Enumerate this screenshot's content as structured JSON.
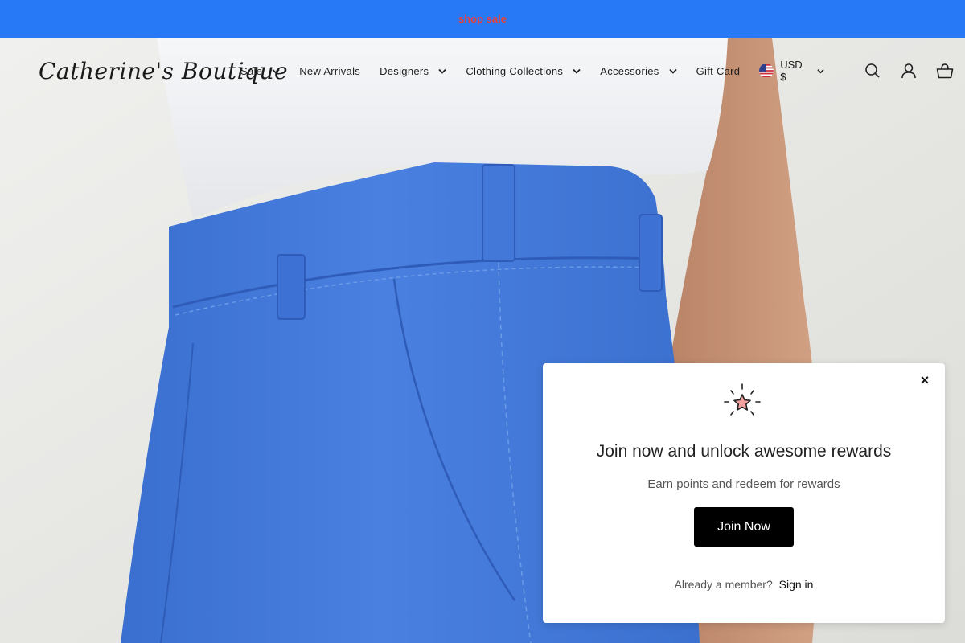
{
  "announcement": {
    "text": "shop sale",
    "color": "#e8423a",
    "background": "#2779f6"
  },
  "header": {
    "logo": "Catherine's Boutique",
    "nav": [
      {
        "label": "Sale",
        "dropdown": true
      },
      {
        "label": "New Arrivals",
        "dropdown": false
      },
      {
        "label": "Designers",
        "dropdown": true
      },
      {
        "label": "Clothing Collections",
        "dropdown": true
      },
      {
        "label": "Accessories",
        "dropdown": true
      },
      {
        "label": "Gift Card",
        "dropdown": false
      }
    ],
    "currency": {
      "label": "USD $",
      "flag": "us-flag-icon"
    },
    "icons": [
      "search-icon",
      "account-icon",
      "cart-icon"
    ]
  },
  "popup": {
    "icon": "sparkle-star-icon",
    "title": "Join now and unlock awesome rewards",
    "subtitle": "Earn points and redeem for rewards",
    "join_label": "Join Now",
    "member_text": "Already a member?",
    "signin_label": "Sign in",
    "close_label": "×"
  }
}
